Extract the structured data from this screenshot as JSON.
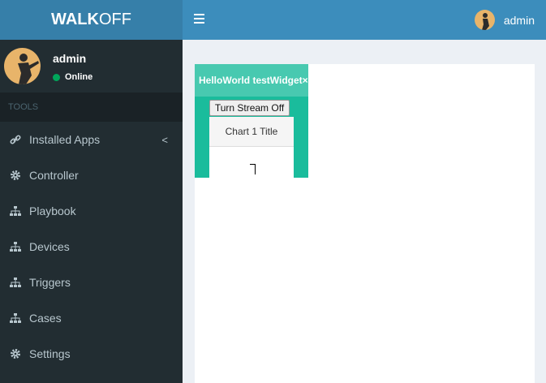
{
  "brand": {
    "bold": "WALK",
    "light": "OFF"
  },
  "header": {
    "user_name": "admin"
  },
  "sidebar": {
    "user_name": "admin",
    "status": "Online",
    "section": "TOOLS",
    "items": [
      {
        "label": "Installed Apps",
        "icon": "link-icon"
      },
      {
        "label": "Controller",
        "icon": "gear-icon"
      },
      {
        "label": "Playbook",
        "icon": "sitemap-icon"
      },
      {
        "label": "Devices",
        "icon": "sitemap-icon"
      },
      {
        "label": "Triggers",
        "icon": "sitemap-icon"
      },
      {
        "label": "Cases",
        "icon": "sitemap-icon"
      },
      {
        "label": "Settings",
        "icon": "gear-icon"
      }
    ]
  },
  "widget": {
    "title": "HelloWorld testWidget",
    "close": "×",
    "button": "Turn Stream Off",
    "chart_title": "Chart 1 Title"
  },
  "colors": {
    "header": "#3c8dbc",
    "logo": "#367fa9",
    "sidebar": "#222d32",
    "widget": "#1abc9c",
    "status": "#00a65a"
  }
}
